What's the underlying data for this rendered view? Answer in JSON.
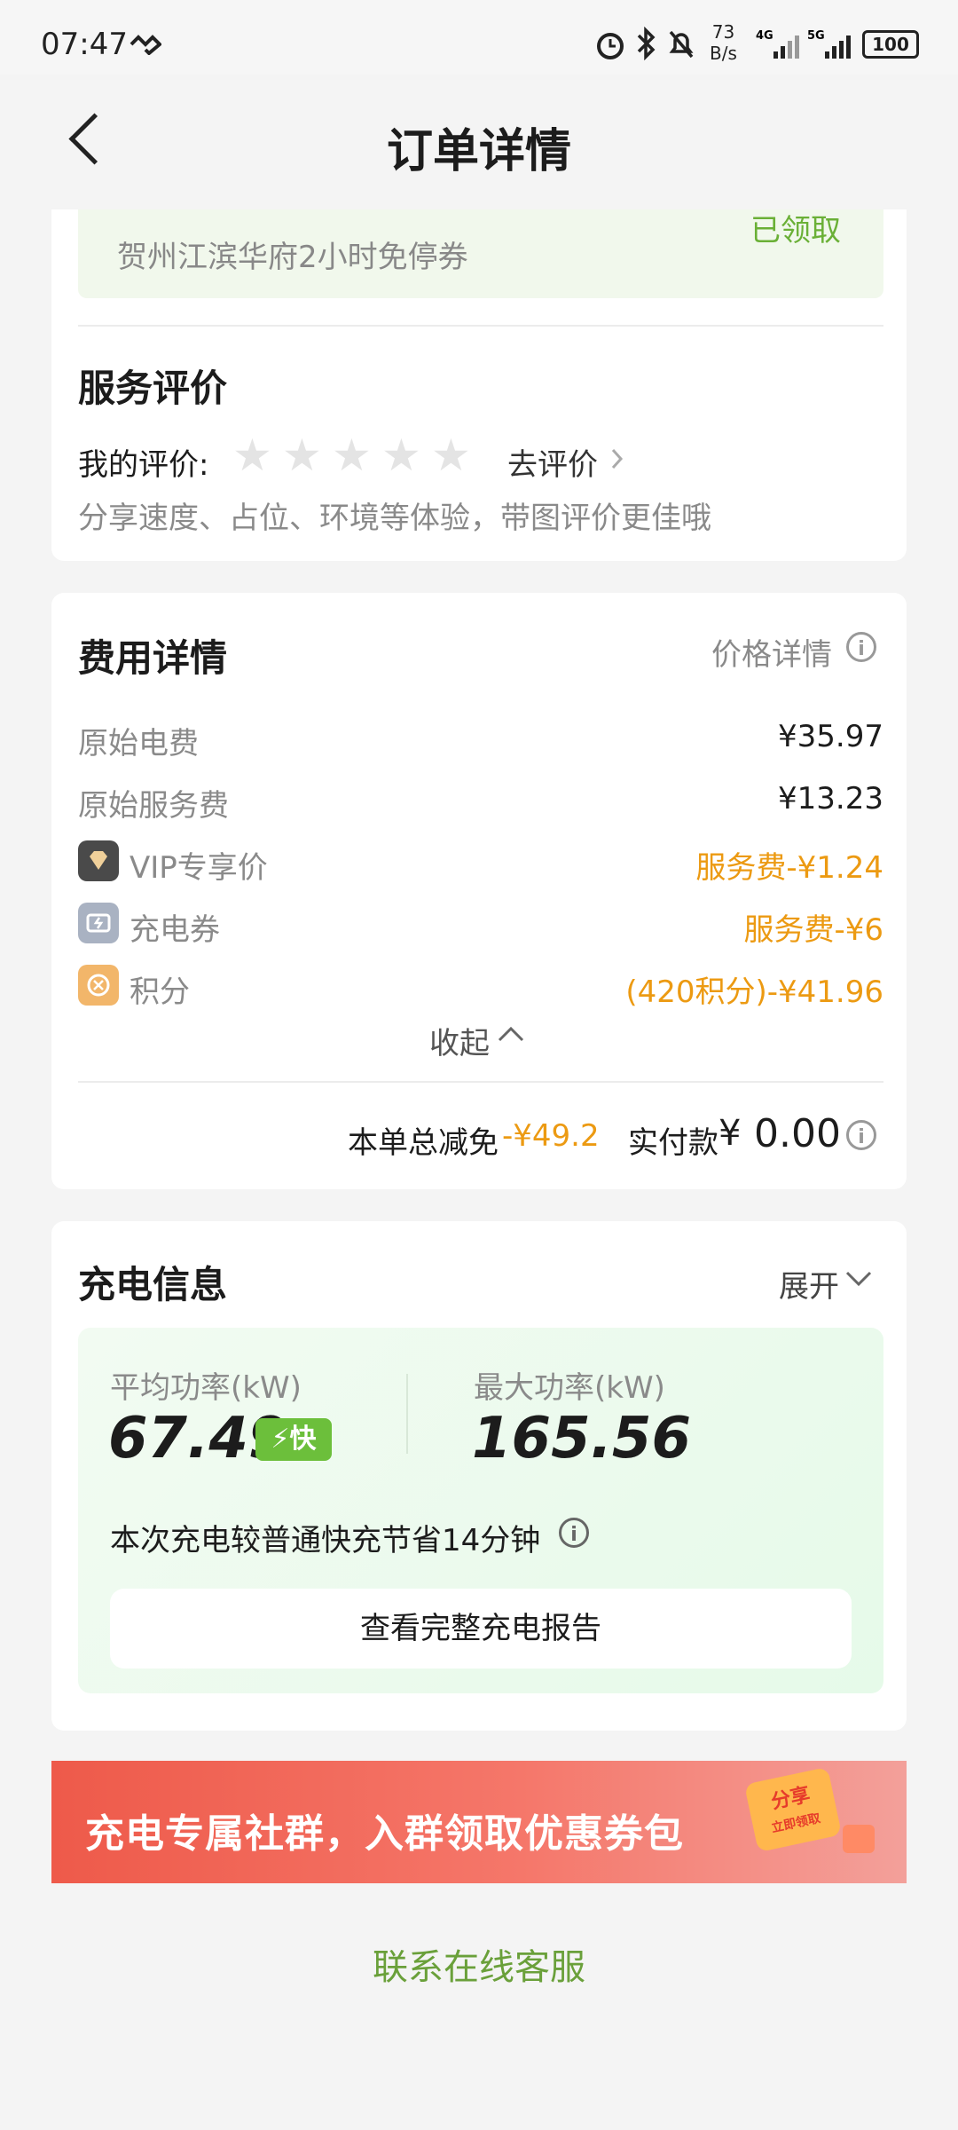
{
  "status": {
    "time": "07:47",
    "net_speed_value": "73",
    "net_speed_unit": "B/s",
    "battery": "100"
  },
  "nav": {
    "title": "订单详情"
  },
  "coupon": {
    "text": "贺州江滨华府2小时免停券",
    "status": "已领取"
  },
  "review": {
    "title": "服务评价",
    "my_label": "我的评价:",
    "stars_filled": 0,
    "stars_total": 5,
    "action": "去评价",
    "hint": "分享速度、占位、环境等体验，带图评价更佳哦"
  },
  "fees": {
    "title": "费用详情",
    "price_detail": "价格详情",
    "rows": [
      {
        "label": "原始电费",
        "value": "¥35.97"
      },
      {
        "label": "原始服务费",
        "value": "¥13.23"
      },
      {
        "label": "VIP专享价",
        "value": "服务费-¥1.24"
      },
      {
        "label": "充电券",
        "value": "服务费-¥6"
      },
      {
        "label": "积分",
        "value": "(420积分)-¥41.96"
      }
    ],
    "collapse": "收起",
    "total_discount_label": "本单总减免",
    "total_discount_value": "-¥49.2",
    "paid_label": "实付款",
    "paid_currency": "¥",
    "paid_value": "0.00",
    "colors": {
      "discount": "#ec9a12"
    }
  },
  "charging": {
    "title": "充电信息",
    "expand": "展开",
    "avg_label": "平均功率(kW)",
    "avg_value": "67.49",
    "fast_tag": "快",
    "max_label": "最大功率(kW)",
    "max_value": "165.56",
    "saved_text": "本次充电较普通快充节省14分钟",
    "report_button": "查看完整充电报告"
  },
  "banner": {
    "text": "充电专属社群，入群领取优惠券包",
    "badge_top": "分享",
    "badge_bottom": "立即领取"
  },
  "footer": {
    "contact": "联系在线客服"
  }
}
